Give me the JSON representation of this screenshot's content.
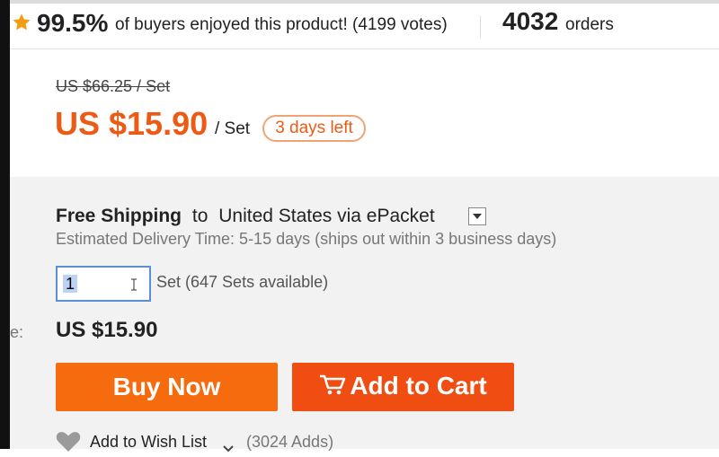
{
  "rating": {
    "percent": "99.5%",
    "text": "of buyers enjoyed this product! (4199 votes)",
    "orders_count": "4032",
    "orders_label": "orders"
  },
  "price": {
    "original": "US $66.25 / Set",
    "sale": "US $15.90",
    "unit": "/ Set",
    "countdown": "3 days left"
  },
  "shipping": {
    "free_label": "Free Shipping",
    "to_label": "to",
    "destination": "United States via ePacket",
    "delivery": "Estimated Delivery Time: 5-15 days (ships out within 3 business days)"
  },
  "quantity": {
    "value": "1",
    "available": "Set (647 Sets available)"
  },
  "total": {
    "label_stub": "e:",
    "price": "US $15.90"
  },
  "actions": {
    "buy_now": "Buy Now",
    "add_to_cart": "Add to Cart"
  },
  "wishlist": {
    "label": "Add to Wish List",
    "adds": "(3024 Adds)"
  },
  "colors": {
    "accent": "#ec5b16",
    "buy_now_bg": "#f66b0e",
    "add_cart_bg": "#f04d12",
    "star": "#f39c12"
  }
}
